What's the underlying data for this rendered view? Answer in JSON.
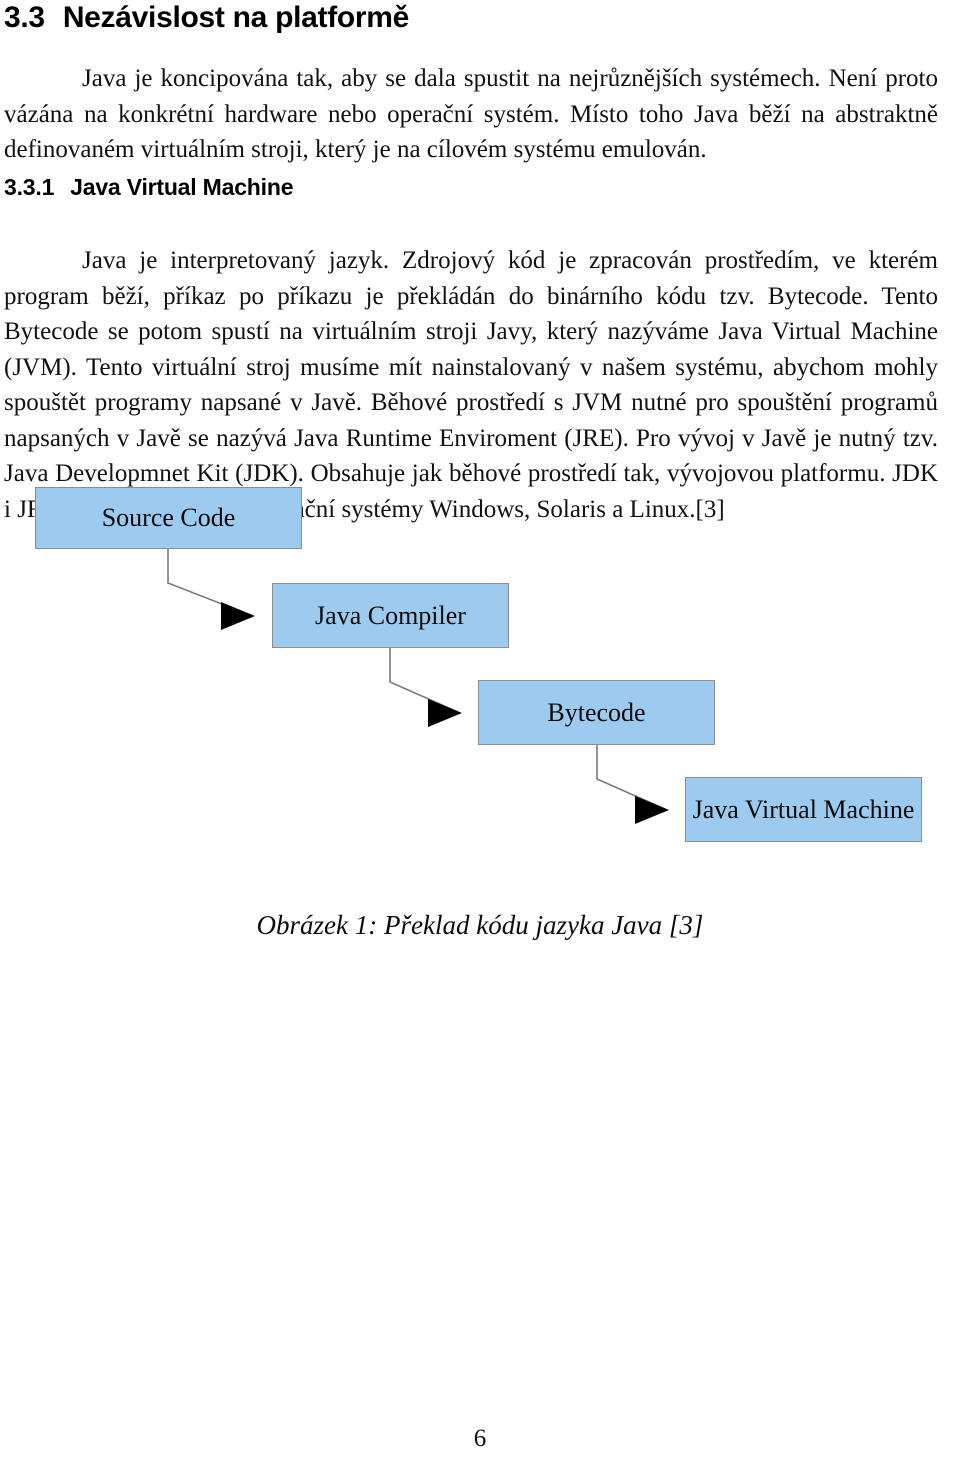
{
  "document": {
    "language": "cs",
    "page_number": "6"
  },
  "section": {
    "number": "3.3",
    "title": "Nezávislost na platformě",
    "body": "Java je koncipována tak, aby se dala spustit na nejrůznějších systémech. Není proto vázána na konkrétní hardware nebo operační systém. Místo toho Java běží na abstraktně definovaném virtuálním stroji, který je na cílovém systému emulován."
  },
  "subsection": {
    "number": "3.3.1",
    "title": "Java Virtual Machine",
    "body": "Java je interpretovaný jazyk. Zdrojový kód je zpracován prostředím, ve kterém program běží, příkaz po příkazu je překládán do binárního kódu tzv. Bytecode. Tento Bytecode se potom spustí na virtuálním stroji Javy, který nazýváme Java Virtual Machine (JVM). Tento virtuální stroj musíme mít nainstalovaný v našem systému, abychom mohly spouštět programy napsané v Javě. Běhové prostředí s JVM nutné pro spouštění programů napsaných v Javě se nazývá Java Runtime Enviroment (JRE). Pro vývoj v Javě je nutný tzv. Java Developmnet Kit (JDK). Obsahuje jak běhové prostředí tak, vývojovou platformu. JDK i JRE jsou dostupné pro operační systémy Windows, Solaris a Linux.[3]"
  },
  "figure": {
    "caption": "Obrázek 1: Překlad kódu jazyka Java [3]",
    "box_fill_color": "#9DCBF0",
    "box_border_color": "#8d8d8d",
    "connector_color": "#7a7a7a",
    "arrow_color": "#000000",
    "nodes": [
      {
        "id": "source",
        "label": "Source Code"
      },
      {
        "id": "compiler",
        "label": "Java Compiler"
      },
      {
        "id": "bytecode",
        "label": "Bytecode"
      },
      {
        "id": "jvm",
        "label": "Java Virtual Machine"
      }
    ],
    "edges": [
      {
        "from": "source",
        "to": "compiler"
      },
      {
        "from": "compiler",
        "to": "bytecode"
      },
      {
        "from": "bytecode",
        "to": "jvm"
      }
    ]
  }
}
